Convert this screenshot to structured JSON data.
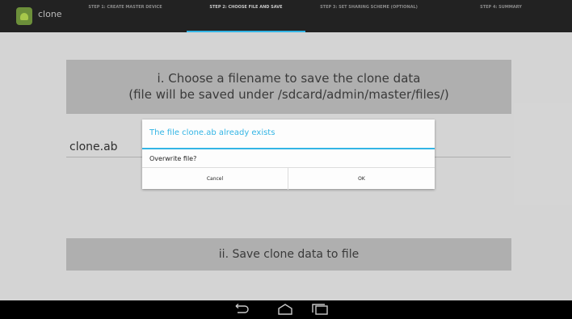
{
  "app": {
    "title": "clone"
  },
  "tabs": [
    {
      "label": "STEP 1: CREATE MASTER DEVICE"
    },
    {
      "label": "STEP 2: CHOOSE FILE AND SAVE"
    },
    {
      "label": "STEP 3: SET SHARING SCHEME (OPTIONAL)"
    },
    {
      "label": "STEP 4: SUMMARY"
    }
  ],
  "main": {
    "choose_line1": "i. Choose a filename to save the clone data",
    "choose_line2": "(file will be saved under /sdcard/admin/master/files/)",
    "filename_value": "clone.ab",
    "save_label": "ii. Save clone data to file"
  },
  "dialog": {
    "title": "The file clone.ab already exists",
    "message": "Overwrite file?",
    "cancel_label": "Cancel",
    "ok_label": "OK"
  },
  "colors": {
    "accent": "#33b5e5",
    "topbar": "#222222",
    "navbar": "#000000"
  },
  "icons": {
    "app": "android-icon",
    "back": "back-icon",
    "home": "home-icon",
    "recents": "recents-icon"
  },
  "state": {
    "active_tab": 1
  }
}
